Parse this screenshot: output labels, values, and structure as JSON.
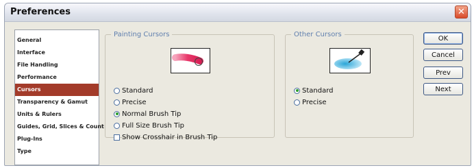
{
  "window": {
    "title": "Preferences",
    "close_glyph": "✕"
  },
  "categories": {
    "items": [
      {
        "label": "General",
        "selected": false
      },
      {
        "label": "Interface",
        "selected": false
      },
      {
        "label": "File Handling",
        "selected": false
      },
      {
        "label": "Performance",
        "selected": false
      },
      {
        "label": "Cursors",
        "selected": true
      },
      {
        "label": "Transparency & Gamut",
        "selected": false
      },
      {
        "label": "Units & Rulers",
        "selected": false
      },
      {
        "label": "Guides, Grid, Slices & Count",
        "selected": false
      },
      {
        "label": "Plug-Ins",
        "selected": false
      },
      {
        "label": "Type",
        "selected": false
      }
    ],
    "selected_color": "#a33b2a"
  },
  "painting_cursors": {
    "legend": "Painting Cursors",
    "preview_icon": "brush-stroke-icon",
    "options": [
      {
        "label": "Standard",
        "selected": false
      },
      {
        "label": "Precise",
        "selected": false
      },
      {
        "label": "Normal Brush Tip",
        "selected": true
      },
      {
        "label": "Full Size Brush Tip",
        "selected": false
      }
    ],
    "crosshair": {
      "label": "Show Crosshair in Brush Tip",
      "checked": false
    }
  },
  "other_cursors": {
    "legend": "Other Cursors",
    "preview_icon": "eyedropper-icon",
    "options": [
      {
        "label": "Standard",
        "selected": true
      },
      {
        "label": "Precise",
        "selected": false
      }
    ]
  },
  "buttons": {
    "ok": "OK",
    "cancel": "Cancel",
    "prev": "Prev",
    "next": "Next"
  },
  "colors": {
    "legend_text": "#5f7fae",
    "brush": "#e8386a",
    "eyedropper_fill": "#2aa6d8"
  }
}
